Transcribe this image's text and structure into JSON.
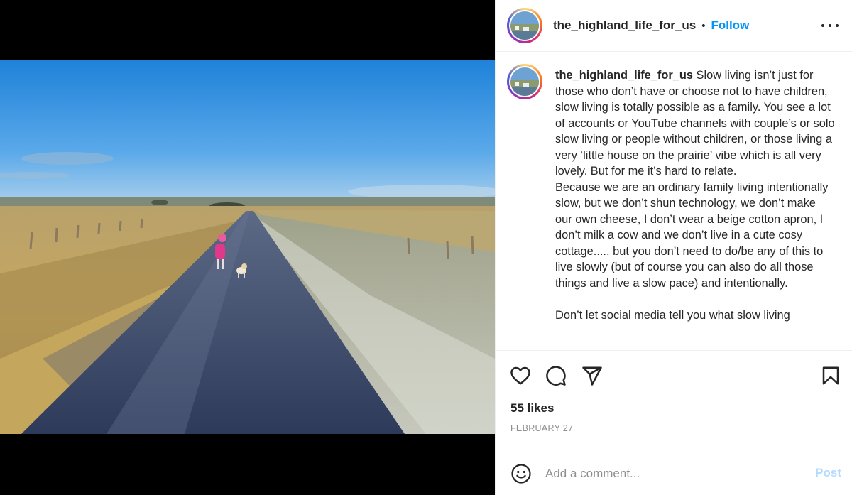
{
  "header": {
    "username": "the_highland_life_for_us",
    "separator": "•",
    "follow_label": "Follow"
  },
  "caption": {
    "username": "the_highland_life_for_us",
    "text": " Slow living isn’t just for those who don’t have or choose not to have children, slow living is totally possible as a family. You see a lot of accounts or YouTube channels with couple’s or solo slow living or people without children, or those living a very ‘little house on the prairie’ vibe which is all very lovely. But for me it’s hard to relate.\nBecause we are an ordinary family living intentionally slow, but we don’t shun technology, we don’t make our own cheese, I don’t wear a beige cotton apron, I don’t milk a cow and we don’t live in a cute cosy cottage..... but you don’t need to do/be any of this to live slowly (but of course you can also do all those things and live a slow pace) and intentionally.\n\nDon’t let social media tell you what slow living"
  },
  "engagement": {
    "likes": "55 likes",
    "date": "FEBRUARY 27"
  },
  "comment": {
    "placeholder": "Add a comment...",
    "post_label": "Post"
  },
  "icons": {
    "like": "heart-icon",
    "comment": "comment-icon",
    "share": "paper-plane-icon",
    "save": "bookmark-icon",
    "emoji": "smiley-icon",
    "more": "more-options-icon"
  },
  "colors": {
    "follow": "#0095f6",
    "post_disabled": "#b3dbff",
    "muted": "#8e8e8e",
    "text": "#262626"
  }
}
